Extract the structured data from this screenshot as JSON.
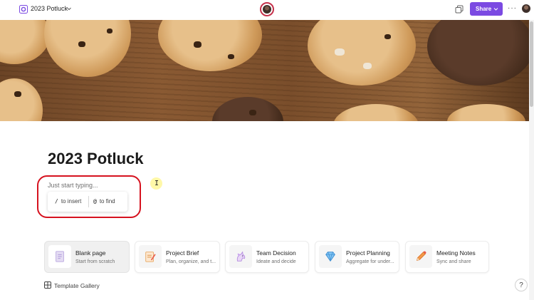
{
  "header": {
    "doc_title": "2023 Potluck",
    "share_label": "Share",
    "more_label": "···",
    "accent_color": "#7b4ae2"
  },
  "banner": {
    "description_icon": "cookies-banner"
  },
  "page": {
    "title": "2023 Potluck",
    "placeholder": "Just start typing...",
    "hints": [
      {
        "key": "/",
        "label": "to insert"
      },
      {
        "key": "@",
        "label": "to find"
      }
    ]
  },
  "templates": [
    {
      "name": "Blank page",
      "description": "Start from scratch",
      "icon": "blank-page-icon"
    },
    {
      "name": "Project Brief",
      "description": "Plan, organize, and t...",
      "icon": "project-brief-icon"
    },
    {
      "name": "Team Decision",
      "description": "Ideate and decide",
      "icon": "unicorn-icon"
    },
    {
      "name": "Project Planning",
      "description": "Aggregate for under...",
      "icon": "gem-icon"
    },
    {
      "name": "Meeting Notes",
      "description": "Sync and share",
      "icon": "pencil-icon"
    }
  ],
  "gallery": {
    "label": "Template Gallery"
  },
  "help": {
    "label": "?"
  },
  "annotation_color": "#d6121f"
}
